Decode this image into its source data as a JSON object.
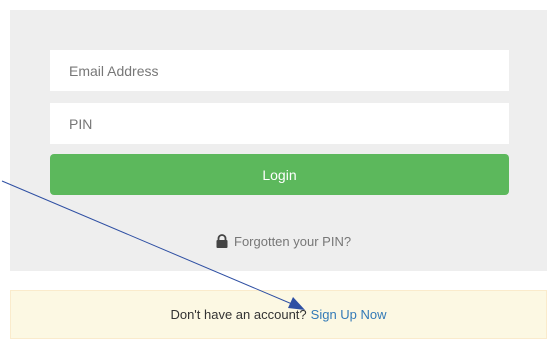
{
  "login_form": {
    "email_placeholder": "Email Address",
    "pin_placeholder": "PIN",
    "login_label": "Login",
    "forgot_pin_label": "Forgotten your PIN?"
  },
  "signup": {
    "prompt": "Don't have an account?",
    "link_label": "Sign Up Now"
  },
  "icons": {
    "forgot_pin": "lock-icon"
  },
  "colors": {
    "panel_background": "#eeeeee",
    "login_button": "#5cb85c",
    "signup_background": "#fcf8e3",
    "link": "#337ab7",
    "annotation_arrow": "#2e4fa3"
  }
}
